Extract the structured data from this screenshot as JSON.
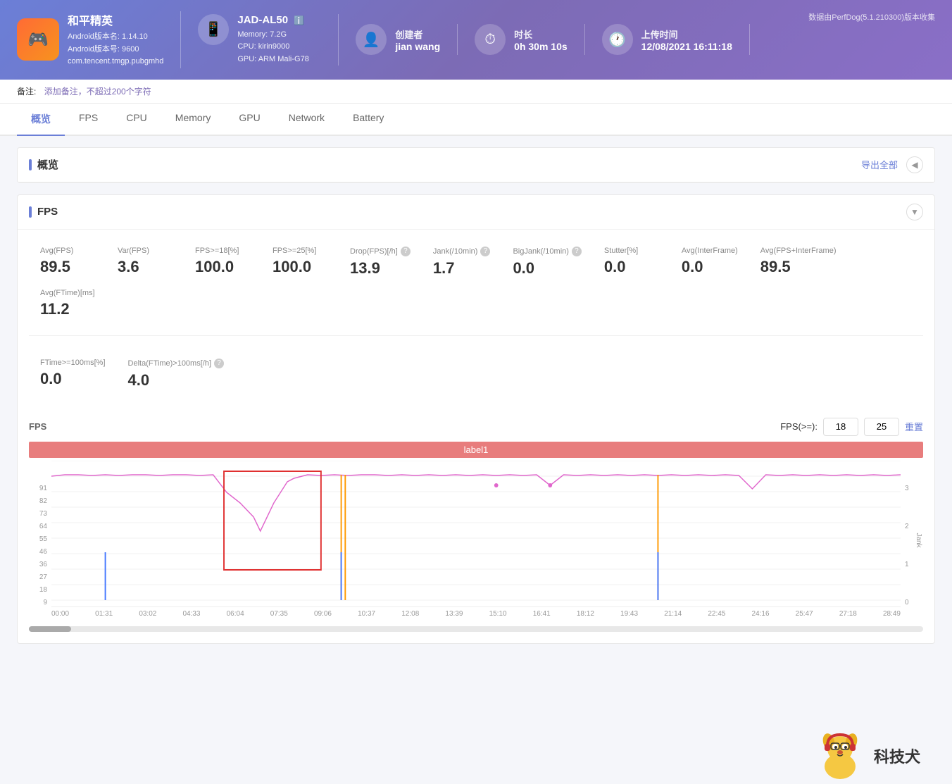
{
  "datasource": "数据由PerfDog(5.1.210300)版本收集",
  "header": {
    "app": {
      "name": "和平精英",
      "android_version_name": "Android版本名: 1.14.10",
      "android_version_code": "Android版本号: 9600",
      "package": "com.tencent.tmgp.pubgmhd",
      "icon_emoji": "🎮"
    },
    "device": {
      "name": "JAD-AL50",
      "memory": "Memory: 7.2G",
      "cpu": "CPU: kirin9000",
      "gpu": "GPU: ARM Mali-G78",
      "icon": "📱",
      "info_icon": "ℹ️"
    },
    "creator": {
      "label": "创建者",
      "value": "jian wang",
      "icon": "👤"
    },
    "duration": {
      "label": "时长",
      "value": "0h 30m 10s",
      "icon": "⏱"
    },
    "upload_time": {
      "label": "上传时间",
      "value": "12/08/2021 16:11:18",
      "icon": "🕐"
    }
  },
  "note": {
    "label": "备注:",
    "placeholder": "添加备注，不超过200个字符"
  },
  "nav": {
    "tabs": [
      "概览",
      "FPS",
      "CPU",
      "Memory",
      "GPU",
      "Network",
      "Battery"
    ],
    "active": "概览"
  },
  "overview": {
    "title": "概览",
    "export_label": "导出全部"
  },
  "fps_section": {
    "title": "FPS",
    "stats": [
      {
        "label": "Avg(FPS)",
        "value": "89.5",
        "help": false
      },
      {
        "label": "Var(FPS)",
        "value": "3.6",
        "help": false
      },
      {
        "label": "FPS>=18[%]",
        "value": "100.0",
        "help": false
      },
      {
        "label": "FPS>=25[%]",
        "value": "100.0",
        "help": false
      },
      {
        "label": "Drop(FPS)[/h]",
        "value": "13.9",
        "help": true
      },
      {
        "label": "Jank(/10min)",
        "value": "1.7",
        "help": true
      },
      {
        "label": "BigJank(/10min)",
        "value": "0.0",
        "help": true
      },
      {
        "label": "Stutter[%]",
        "value": "0.0",
        "help": false
      },
      {
        "label": "Avg(InterFrame)",
        "value": "0.0",
        "help": false
      },
      {
        "label": "Avg(FPS+InterFrame)",
        "value": "89.5",
        "help": false
      },
      {
        "label": "Avg(FTime)[ms]",
        "value": "11.2",
        "help": false
      }
    ],
    "stats2": [
      {
        "label": "FTime>=100ms[%]",
        "value": "0.0",
        "help": false
      },
      {
        "label": "Delta(FTime)>100ms[/h]",
        "value": "4.0",
        "help": true
      }
    ],
    "chart": {
      "label": "FPS",
      "fps_ge_label": "FPS(>=):",
      "fps_val1": "18",
      "fps_val2": "25",
      "reset_label": "重置",
      "label1": "label1",
      "y_labels": [
        "91",
        "82",
        "73",
        "64",
        "55",
        "46",
        "36",
        "27",
        "18",
        "9"
      ],
      "jank_labels": [
        "3",
        "2",
        "1",
        "0"
      ],
      "time_labels": [
        "00:00",
        "01:31",
        "03:02",
        "04:33",
        "06:04",
        "07:35",
        "09:06",
        "10:37",
        "12:08",
        "13:39",
        "15:10",
        "16:41",
        "18:12",
        "19:43",
        "21:14",
        "22:45",
        "24:16",
        "25:47",
        "27:18",
        "28:49"
      ]
    }
  },
  "watermark": "科技犬"
}
